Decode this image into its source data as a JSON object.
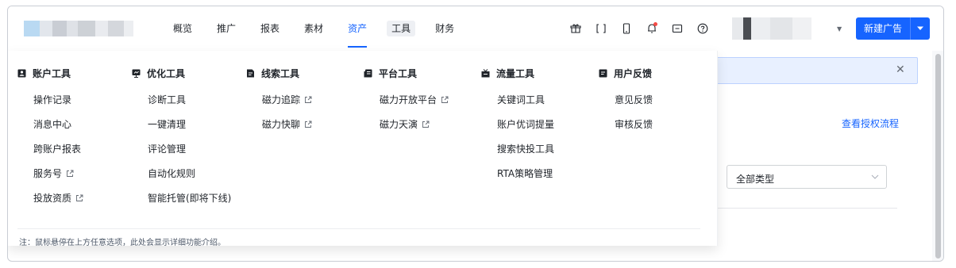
{
  "nav": {
    "items": [
      {
        "label": "概览",
        "state": "normal"
      },
      {
        "label": "推广",
        "state": "normal"
      },
      {
        "label": "报表",
        "state": "normal"
      },
      {
        "label": "素材",
        "state": "normal"
      },
      {
        "label": "资产",
        "state": "active"
      },
      {
        "label": "工具",
        "state": "hover"
      },
      {
        "label": "财务",
        "state": "normal"
      }
    ],
    "utility_icons": [
      "gift-icon",
      "crop-icon",
      "mobile-icon",
      "bell-icon",
      "message-icon",
      "help-icon"
    ],
    "new_ad_label": "新建广告"
  },
  "dropdown": {
    "columns": [
      {
        "title": "账户工具",
        "icon": "account-icon",
        "items": [
          {
            "label": "操作记录",
            "external": false
          },
          {
            "label": "消息中心",
            "external": false
          },
          {
            "label": "跨账户报表",
            "external": false
          },
          {
            "label": "服务号",
            "external": true
          },
          {
            "label": "投放资质",
            "external": true
          }
        ]
      },
      {
        "title": "优化工具",
        "icon": "monitor-icon",
        "items": [
          {
            "label": "诊断工具",
            "external": false
          },
          {
            "label": "一键清理",
            "external": false
          },
          {
            "label": "评论管理",
            "external": false
          },
          {
            "label": "自动化规则",
            "external": false
          },
          {
            "label": "智能托管(即将下线)",
            "external": false
          }
        ]
      },
      {
        "title": "线索工具",
        "icon": "clue-icon",
        "items": [
          {
            "label": "磁力追踪",
            "external": true
          },
          {
            "label": "磁力快聊",
            "external": true
          }
        ]
      },
      {
        "title": "平台工具",
        "icon": "platform-icon",
        "items": [
          {
            "label": "磁力开放平台",
            "external": true
          },
          {
            "label": "磁力天演",
            "external": true
          }
        ]
      },
      {
        "title": "流量工具",
        "icon": "traffic-icon",
        "items": [
          {
            "label": "关键词工具",
            "external": false
          },
          {
            "label": "账户优词提量",
            "external": false
          },
          {
            "label": "搜索快投工具",
            "external": false
          },
          {
            "label": "RTA策略管理",
            "external": false
          }
        ]
      },
      {
        "title": "用户反馈",
        "icon": "feedback-icon",
        "items": [
          {
            "label": "意见反馈",
            "external": false
          },
          {
            "label": "审核反馈",
            "external": false
          }
        ]
      }
    ],
    "note": "注：鼠标悬停在上方任意选项，此处会显示详细功能介绍。"
  },
  "background": {
    "link_label": "查看授权流程",
    "select_value": "全部类型"
  },
  "colors": {
    "accent": "#1664ff",
    "text": "#1f2329",
    "muted": "#4e5969"
  }
}
